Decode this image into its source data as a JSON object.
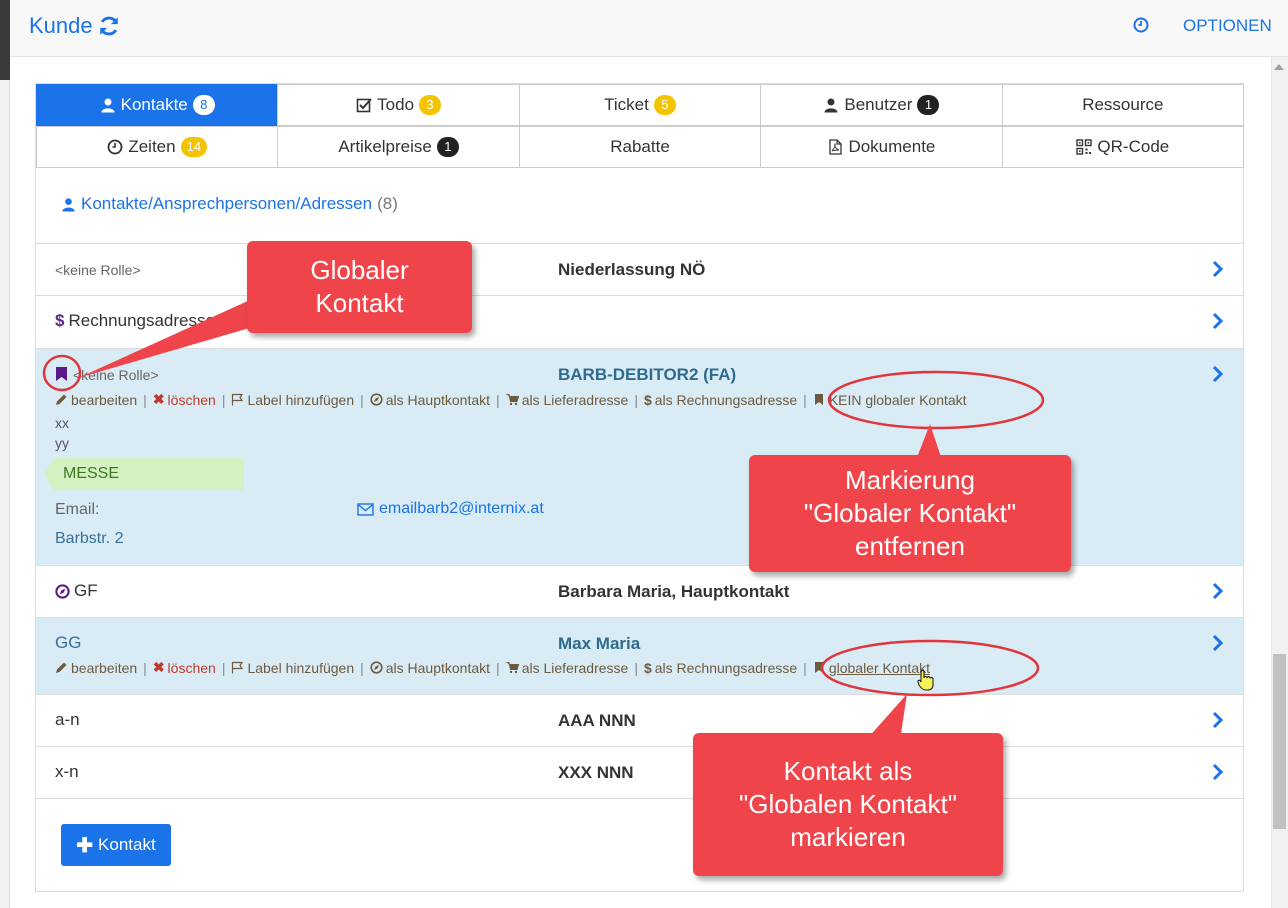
{
  "header": {
    "title": "Kunde",
    "options_label": "OPTIONEN"
  },
  "tabs": {
    "row1": [
      {
        "label": "Kontakte",
        "badge": "8"
      },
      {
        "label": "Todo",
        "badge": "3"
      },
      {
        "label": "Ticket",
        "badge": "5"
      },
      {
        "label": "Benutzer",
        "badge": "1"
      },
      {
        "label": "Ressource"
      }
    ],
    "row2": [
      {
        "label": "Zeiten",
        "badge": "14"
      },
      {
        "label": "Artikelpreise",
        "badge": "1"
      },
      {
        "label": "Rabatte"
      },
      {
        "label": "Dokumente"
      },
      {
        "label": "QR-Code"
      }
    ]
  },
  "section": {
    "title": "Kontakte/Ansprechpersonen/Adressen",
    "count": "(8)"
  },
  "contacts": [
    {
      "role": "<keine Rolle>",
      "name": "Niederlassung NÖ"
    },
    {
      "role": "Rechnungsadresse",
      "name": ""
    },
    {
      "role": "<keine Rolle>",
      "name": "BARB-DEBITOR2 (FA)",
      "actions": {
        "edit": "bearbeiten",
        "delete": "löschen",
        "add_label": "Label hinzufügen",
        "main_contact": "als Hauptkontakt",
        "delivery": "als Lieferadresse",
        "billing": "als Rechnungsadresse",
        "global": "KEIN globaler Kontakt"
      },
      "line1": "xx",
      "line2": "yy",
      "label": "MESSE",
      "email_label": "Email:",
      "email": "emailbarb2@internix.at",
      "street": "Barbstr. 2"
    },
    {
      "role": "GF",
      "name": "Barbara Maria, Hauptkontakt"
    },
    {
      "role": "GG",
      "name": "Max Maria",
      "actions": {
        "edit": "bearbeiten",
        "delete": "löschen",
        "add_label": "Label hinzufügen",
        "main_contact": "als Hauptkontakt",
        "delivery": "als Lieferadresse",
        "billing": "als Rechnungsadresse",
        "global": "globaler Kontakt"
      }
    },
    {
      "role": "a-n",
      "name": "AAA NNN"
    },
    {
      "role": "x-n",
      "name": "XXX NNN"
    }
  ],
  "add_button": "Kontakt",
  "callouts": {
    "global": "Globaler\nKontakt",
    "remove": "Markierung\n\"Globaler Kontakt\"\nentfernen",
    "mark": "Kontakt als\n\"Globalen Kontakt\"\nmarkieren"
  },
  "colors": {
    "primary": "#1a73e8",
    "highlight_row": "#d9ecf6",
    "callout": "#f0444b",
    "badge_yellow": "#f5c400",
    "label_green": "#d4f1c2"
  }
}
